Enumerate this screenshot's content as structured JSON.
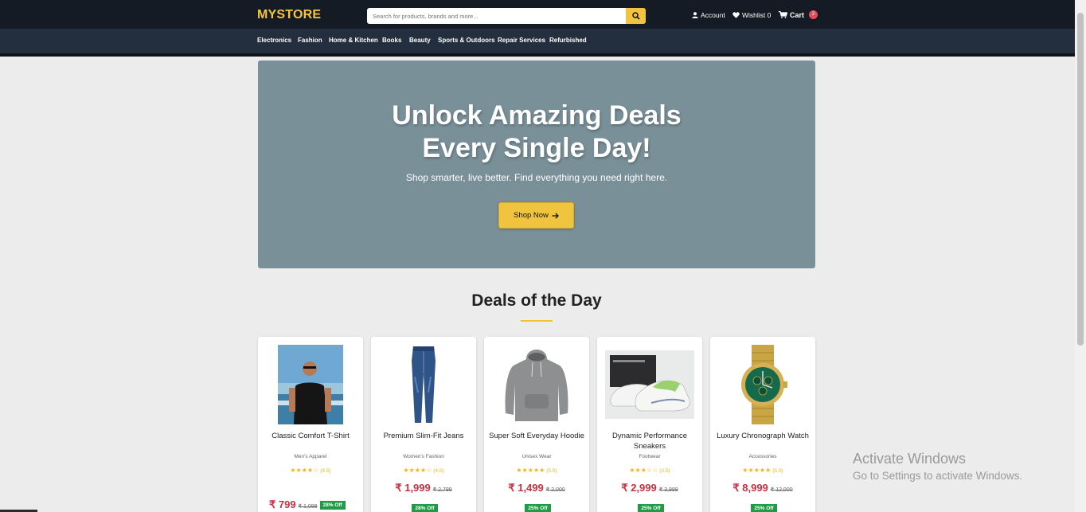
{
  "header": {
    "logo": "MYSTORE",
    "search_placeholder": "Search for products, brands and more...",
    "account": "Account",
    "wishlist": "Wishlist 0",
    "cart": "Cart",
    "cart_count": "2"
  },
  "categories": [
    "Electronics",
    "Fashion",
    "Home & Kitchen",
    "Books",
    "Beauty",
    "Sports & Outdoors",
    "Repair Services",
    "Refurbished"
  ],
  "hero": {
    "title_line1": "Unlock Amazing Deals",
    "title_line2": "Every Single Day!",
    "subtitle": "Shop smarter, live better. Find everything you need right here.",
    "button": "Shop Now"
  },
  "section": {
    "title": "Deals of the Day"
  },
  "products": [
    {
      "name": "Classic Comfort T-Shirt",
      "category": "Men's Apparel",
      "stars": "★★★★☆",
      "rating": "(4.5)",
      "price": "₹ 799",
      "old_price": "₹ 1,099",
      "discount": "28% Off"
    },
    {
      "name": "Premium Slim-Fit Jeans",
      "category": "Women's Fashion",
      "stars": "★★★★☆",
      "rating": "(4.0)",
      "price": "₹ 1,999",
      "old_price": "₹ 2,799",
      "discount": "28% Off"
    },
    {
      "name": "Super Soft Everyday Hoodie",
      "category": "Unisex Wear",
      "stars": "★★★★★",
      "rating": "(5.0)",
      "price": "₹ 1,499",
      "old_price": "₹ 2,000",
      "discount": "25% Off"
    },
    {
      "name": "Dynamic Performance Sneakers",
      "category": "Footwear",
      "stars": "★★★☆☆",
      "rating": "(3.5)",
      "price": "₹ 2,999",
      "old_price": "₹ 3,999",
      "discount": "25% Off"
    },
    {
      "name": "Luxury Chronograph Watch",
      "category": "Accessories",
      "stars": "★★★★★",
      "rating": "(5.0)",
      "price": "₹ 8,999",
      "old_price": "₹ 12,000",
      "discount": "25% Off"
    }
  ],
  "watermark": {
    "line1": "Activate Windows",
    "line2": "Go to Settings to activate Windows."
  },
  "colors": {
    "topbar": "#151b25",
    "catbar": "#232f3e",
    "accent": "#f1c43f",
    "hero_bg": "#7a9098",
    "price": "#c8303f",
    "discount": "#1f9d44"
  }
}
